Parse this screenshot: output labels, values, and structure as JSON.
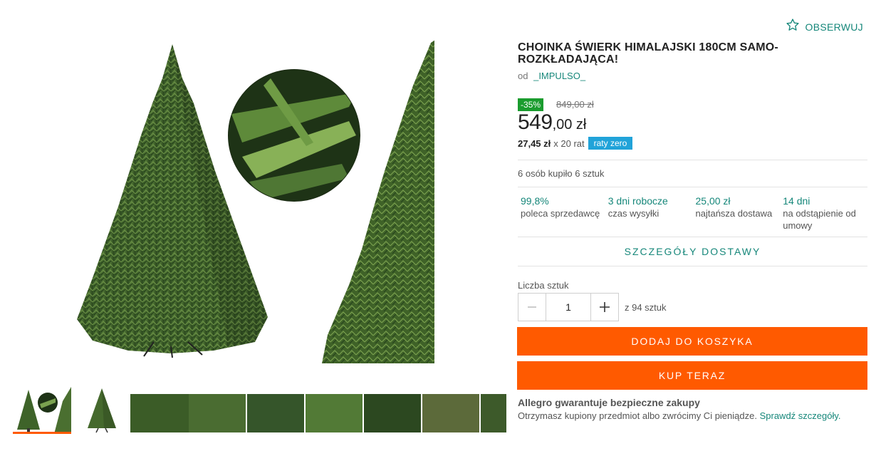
{
  "watch": {
    "label": "OBSERWUJ",
    "icon": "star-outline-icon"
  },
  "product": {
    "title": "CHOINKA ŚWIERK HIMALAJSKI 180CM SAMO-ROZKŁADAJĄCA!",
    "seller_prefix": "od",
    "seller_name": "_IMPULSO_"
  },
  "pricing": {
    "discount": "-35%",
    "old_price": "849,00 zł",
    "price_main": "549",
    "price_rest": ",00 zł",
    "installment_amount": "27,45 zł",
    "installment_count": "x 20 rat",
    "installment_badge": "raty zero"
  },
  "bought_text": "6 osób kupiło 6 sztuk",
  "stats": [
    {
      "value": "99,8%",
      "desc": "poleca sprzedawcę"
    },
    {
      "value": "3 dni robocze",
      "desc": "czas wysyłki"
    },
    {
      "value": "25,00 zł",
      "desc": "najtańsza dostawa"
    },
    {
      "value": "14 dni",
      "desc": "na odstąpienie od umowy"
    }
  ],
  "shipping_link": "SZCZEGÓŁY DOSTAWY",
  "quantity": {
    "label": "Liczba sztuk",
    "value": "1",
    "available": "z 94 sztuk"
  },
  "buttons": {
    "add_to_cart": "DODAJ DO KOSZYKA",
    "buy_now": "KUP TERAZ"
  },
  "guarantee": {
    "title": "Allegro gwarantuje bezpieczne zakupy",
    "text": "Otrzymasz kupiony przedmiot albo zwrócimy Ci pieniądze.",
    "link": "Sprawdź szczegóły."
  },
  "colors": {
    "accent": "#16877a",
    "cta": "#ff5a00",
    "discount": "#1a9c2e",
    "raty": "#21a3d9"
  }
}
